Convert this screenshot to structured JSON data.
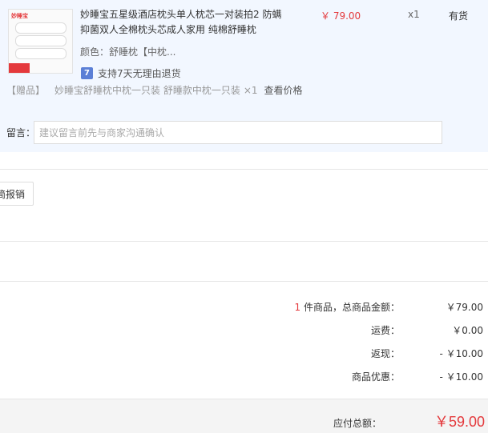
{
  "item": {
    "title": "妙睡宝五星级酒店枕头单人枕芯一对装拍2 防螨抑菌双人全棉枕头芯成人家用 纯棉舒睡枕",
    "image_brand": "妙睡宝",
    "price": "￥ 79.00",
    "quantity": "x1",
    "stock_status": "有货",
    "attribute": "颜色：舒睡枕【中枕...",
    "service_icon": "7",
    "service_text": "支持7天无理由退货"
  },
  "gift": {
    "tag": "【赠品】",
    "name": "妙睡宝舒睡枕中枕一只装 舒睡款中枕一只装",
    "quantity": "×1",
    "link": "查看价格"
  },
  "remark": {
    "label": "留言：",
    "placeholder": "建议留言前先与商家沟通确认"
  },
  "invoice_button": "简报销",
  "summary": {
    "count": "1",
    "count_suffix": " 件商品，总商品金额：",
    "goods_total": "￥79.00",
    "freight_label": "运费：",
    "freight": "￥0.00",
    "cashback_label": "返现：",
    "cashback": "- ￥10.00",
    "discount_label": "商品优惠：",
    "discount": "- ￥10.00"
  },
  "total": {
    "label": "应付总额：",
    "amount": "￥59.00"
  },
  "colors": {
    "accent": "#e4393c",
    "panel_bg": "#f2f7ff",
    "service_icon": "#5b7fd6"
  }
}
